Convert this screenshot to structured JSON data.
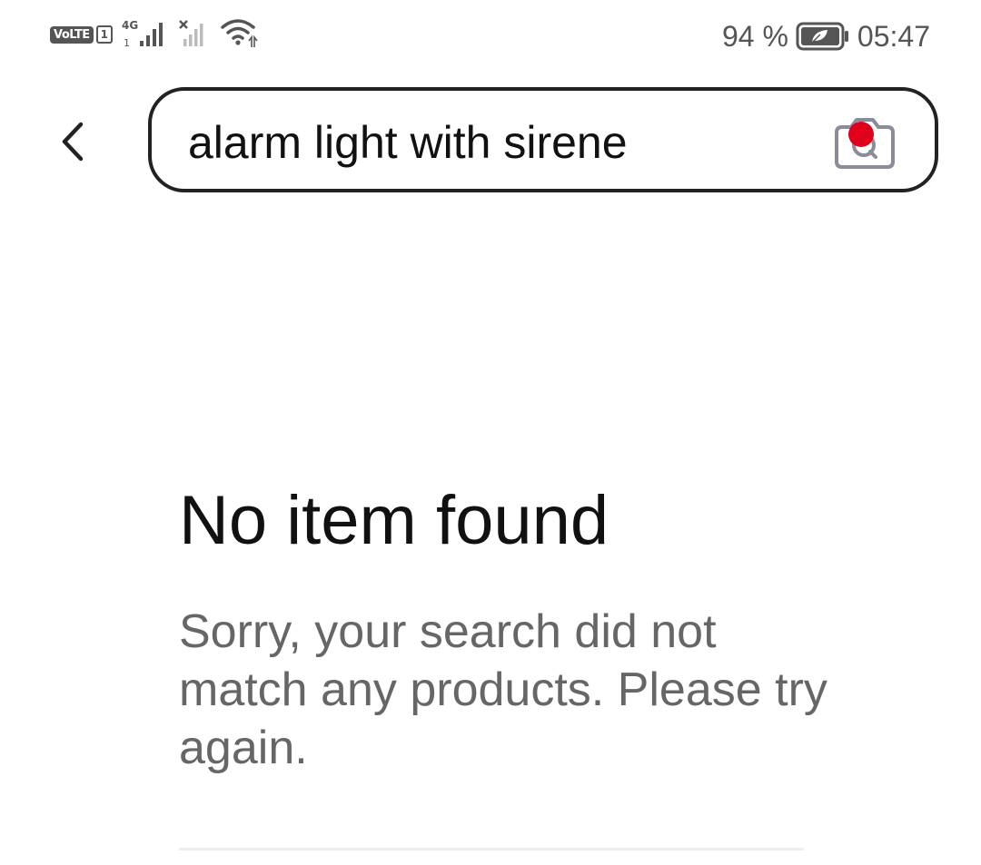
{
  "status_bar": {
    "volte_label": "VoLTE",
    "sim_label": "1",
    "network_label": "4G",
    "battery_percent": "94 %",
    "time": "05:47"
  },
  "search": {
    "query": "alarm light with sirene",
    "notification_color": "#e0001b"
  },
  "empty_state": {
    "title": "No item found",
    "message": "Sorry, your search did not match any products. Please try again."
  },
  "icons": {
    "back": "chevron-left-icon",
    "camera": "camera-search-icon",
    "wifi": "wifi-icon",
    "battery": "battery-icon"
  }
}
